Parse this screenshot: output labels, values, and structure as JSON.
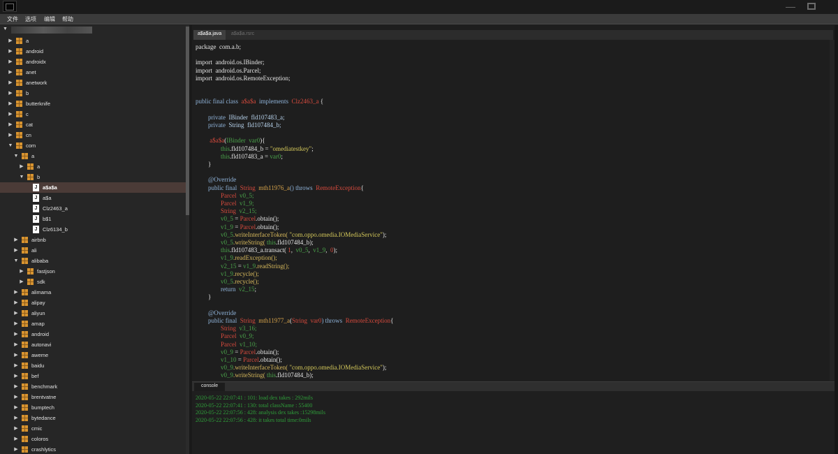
{
  "window": {
    "controls": {
      "minimize": "—",
      "maximize": "",
      "close": ""
    }
  },
  "menu": [
    "文件",
    "选项",
    "编辑",
    "帮助"
  ],
  "tree": [
    {
      "label": "a",
      "arrow": "▶",
      "icon": "folder",
      "depth": 0
    },
    {
      "label": "android",
      "arrow": "▶",
      "icon": "folder",
      "depth": 0
    },
    {
      "label": "androidx",
      "arrow": "▶",
      "icon": "folder",
      "depth": 0
    },
    {
      "label": "anet",
      "arrow": "▶",
      "icon": "folder",
      "depth": 0
    },
    {
      "label": "anetwork",
      "arrow": "▶",
      "icon": "folder",
      "depth": 0
    },
    {
      "label": "b",
      "arrow": "▶",
      "icon": "folder",
      "depth": 0
    },
    {
      "label": "butterknife",
      "arrow": "▶",
      "icon": "folder",
      "depth": 0
    },
    {
      "label": "c",
      "arrow": "▶",
      "icon": "folder",
      "depth": 0
    },
    {
      "label": "cat",
      "arrow": "▶",
      "icon": "folder",
      "depth": 0
    },
    {
      "label": "cn",
      "arrow": "▶",
      "icon": "folder",
      "depth": 0
    },
    {
      "label": "com",
      "arrow": "▼",
      "icon": "folder",
      "depth": 0
    },
    {
      "label": "a",
      "arrow": "▼",
      "icon": "folder",
      "depth": 1
    },
    {
      "label": "a",
      "arrow": "▶",
      "icon": "folder",
      "depth": 2
    },
    {
      "label": "b",
      "arrow": "▼",
      "icon": "folder",
      "depth": 2
    },
    {
      "label": "a$a$a",
      "arrow": "",
      "icon": "file",
      "depth": 3,
      "selected": true
    },
    {
      "label": "a$a",
      "arrow": "",
      "icon": "file",
      "depth": 3
    },
    {
      "label": "Clz2463_a",
      "arrow": "",
      "icon": "file",
      "depth": 3
    },
    {
      "label": "b$1",
      "arrow": "",
      "icon": "file",
      "depth": 3
    },
    {
      "label": "Clz6134_b",
      "arrow": "",
      "icon": "file",
      "depth": 3
    },
    {
      "label": "airbnb",
      "arrow": "▶",
      "icon": "folder",
      "depth": 1
    },
    {
      "label": "ali",
      "arrow": "▶",
      "icon": "folder",
      "depth": 1
    },
    {
      "label": "alibaba",
      "arrow": "▼",
      "icon": "folder",
      "depth": 1
    },
    {
      "label": "fastjson",
      "arrow": "▶",
      "icon": "folder",
      "depth": 2
    },
    {
      "label": "sdk",
      "arrow": "▶",
      "icon": "folder",
      "depth": 2
    },
    {
      "label": "alimama",
      "arrow": "▶",
      "icon": "folder",
      "depth": 1
    },
    {
      "label": "alipay",
      "arrow": "▶",
      "icon": "folder",
      "depth": 1
    },
    {
      "label": "aliyun",
      "arrow": "▶",
      "icon": "folder",
      "depth": 1
    },
    {
      "label": "amap",
      "arrow": "▶",
      "icon": "folder",
      "depth": 1
    },
    {
      "label": "android",
      "arrow": "▶",
      "icon": "folder",
      "depth": 1
    },
    {
      "label": "autonavi",
      "arrow": "▶",
      "icon": "folder",
      "depth": 1
    },
    {
      "label": "aweme",
      "arrow": "▶",
      "icon": "folder",
      "depth": 1
    },
    {
      "label": "baidu",
      "arrow": "▶",
      "icon": "folder",
      "depth": 1
    },
    {
      "label": "bef",
      "arrow": "▶",
      "icon": "folder",
      "depth": 1
    },
    {
      "label": "benchmark",
      "arrow": "▶",
      "icon": "folder",
      "depth": 1
    },
    {
      "label": "brentvatne",
      "arrow": "▶",
      "icon": "folder",
      "depth": 1
    },
    {
      "label": "bumptech",
      "arrow": "▶",
      "icon": "folder",
      "depth": 1
    },
    {
      "label": "bytedance",
      "arrow": "▶",
      "icon": "folder",
      "depth": 1
    },
    {
      "label": "cmic",
      "arrow": "▶",
      "icon": "folder",
      "depth": 1
    },
    {
      "label": "coloros",
      "arrow": "▶",
      "icon": "folder",
      "depth": 1
    },
    {
      "label": "crashlytics",
      "arrow": "▶",
      "icon": "folder",
      "depth": 1
    }
  ],
  "tabs": [
    "a$a$a.java",
    "a$a$a.rsrc"
  ],
  "code": [
    [
      {
        "t": "package  com.a.b;",
        "c": "s"
      }
    ],
    [],
    [
      {
        "t": "import  android.os.IBinder;",
        "c": "s"
      }
    ],
    [
      {
        "t": "import  android.os.Parcel;",
        "c": "s"
      }
    ],
    [
      {
        "t": "import  android.os.RemoteException;",
        "c": "s"
      }
    ],
    [],
    [],
    [
      {
        "t": "public final class  ",
        "c": "k"
      },
      {
        "t": "a$a$a",
        "c": "r"
      },
      {
        "t": "  implements  ",
        "c": "k"
      },
      {
        "t": "Clz2463_a",
        "c": "r"
      },
      {
        "t": " {",
        "c": "s"
      }
    ],
    [],
    [
      {
        "t": "        private  ",
        "c": "k"
      },
      {
        "t": "IBinder",
        "c": "t"
      },
      {
        "t": "  fld107483_a;",
        "c": "t"
      }
    ],
    [
      {
        "t": "        private  ",
        "c": "k"
      },
      {
        "t": "String",
        "c": "t"
      },
      {
        "t": "  fld107484_b;",
        "c": "t"
      }
    ],
    [],
    [
      {
        "t": "         ",
        "c": "s"
      },
      {
        "t": "a$a$a",
        "c": "r"
      },
      {
        "t": "(",
        "c": "s"
      },
      {
        "t": "IBinder  var0",
        "c": "g"
      },
      {
        "t": "){",
        "c": "s"
      }
    ],
    [
      {
        "t": "                ",
        "c": "s"
      },
      {
        "t": "this",
        "c": "g"
      },
      {
        "t": ".fld107484_b = ",
        "c": "s"
      },
      {
        "t": "\"omediatestkey\"",
        "c": "y"
      },
      {
        "t": ";",
        "c": "s"
      }
    ],
    [
      {
        "t": "                ",
        "c": "s"
      },
      {
        "t": "this",
        "c": "g"
      },
      {
        "t": ".fld107483_a = ",
        "c": "s"
      },
      {
        "t": "var0",
        "c": "g"
      },
      {
        "t": ";",
        "c": "s"
      }
    ],
    [
      {
        "t": "        }",
        "c": "s"
      }
    ],
    [],
    [
      {
        "t": "        @Override",
        "c": "k"
      }
    ],
    [
      {
        "t": "        public final  ",
        "c": "k"
      },
      {
        "t": "String",
        "c": "r"
      },
      {
        "t": "  mth11976_a",
        "c": "o"
      },
      {
        "t": "() throws  ",
        "c": "k"
      },
      {
        "t": "RemoteException",
        "c": "r"
      },
      {
        "t": "{",
        "c": "s"
      }
    ],
    [
      {
        "t": "                Parcel",
        "c": "r"
      },
      {
        "t": "  v0_5;",
        "c": "g"
      }
    ],
    [
      {
        "t": "                Parcel",
        "c": "r"
      },
      {
        "t": "  v1_9;",
        "c": "g"
      }
    ],
    [
      {
        "t": "                String",
        "c": "r"
      },
      {
        "t": "  v2_15;",
        "c": "g"
      }
    ],
    [
      {
        "t": "                v0_5",
        "c": "g"
      },
      {
        "t": " = ",
        "c": "s"
      },
      {
        "t": "Parcel",
        "c": "r"
      },
      {
        "t": ".obtain();",
        "c": "s"
      }
    ],
    [
      {
        "t": "                v1_9",
        "c": "g"
      },
      {
        "t": " = ",
        "c": "s"
      },
      {
        "t": "Parcel",
        "c": "r"
      },
      {
        "t": ".obtain();",
        "c": "s"
      }
    ],
    [
      {
        "t": "                v0_5",
        "c": "g"
      },
      {
        "t": ".writeInterfaceToken( ",
        "c": "m"
      },
      {
        "t": "\"com.oppo.omedia.IOMediaService\"",
        "c": "y"
      },
      {
        "t": ");",
        "c": "s"
      }
    ],
    [
      {
        "t": "                v0_5",
        "c": "g"
      },
      {
        "t": ".writeString( ",
        "c": "m"
      },
      {
        "t": "this",
        "c": "g"
      },
      {
        "t": ".fld107484_b);",
        "c": "s"
      }
    ],
    [
      {
        "t": "                this",
        "c": "g"
      },
      {
        "t": ".fld107483_a.transact( ",
        "c": "s"
      },
      {
        "t": "1",
        "c": "r"
      },
      {
        "t": ",  ",
        "c": "s"
      },
      {
        "t": "v0_5",
        "c": "g"
      },
      {
        "t": ",  ",
        "c": "s"
      },
      {
        "t": "v1_9",
        "c": "g"
      },
      {
        "t": ",  ",
        "c": "s"
      },
      {
        "t": "0",
        "c": "r"
      },
      {
        "t": ");",
        "c": "s"
      }
    ],
    [
      {
        "t": "                v1_9",
        "c": "g"
      },
      {
        "t": ".readException();",
        "c": "m"
      }
    ],
    [
      {
        "t": "                v2_15",
        "c": "g"
      },
      {
        "t": " = ",
        "c": "s"
      },
      {
        "t": "v1_9",
        "c": "g"
      },
      {
        "t": ".readString();",
        "c": "m"
      }
    ],
    [
      {
        "t": "                v1_9",
        "c": "g"
      },
      {
        "t": ".recycle();",
        "c": "m"
      }
    ],
    [
      {
        "t": "                v0_5",
        "c": "g"
      },
      {
        "t": ".recycle();",
        "c": "m"
      }
    ],
    [
      {
        "t": "                return  ",
        "c": "k"
      },
      {
        "t": "v2_15",
        "c": "g"
      },
      {
        "t": ";",
        "c": "s"
      }
    ],
    [
      {
        "t": "        }",
        "c": "s"
      }
    ],
    [],
    [
      {
        "t": "        @Override",
        "c": "k"
      }
    ],
    [
      {
        "t": "        public final  ",
        "c": "k"
      },
      {
        "t": "String",
        "c": "r"
      },
      {
        "t": "  mth11977_a",
        "c": "o"
      },
      {
        "t": "(",
        "c": "s"
      },
      {
        "t": "String  var0",
        "c": "r"
      },
      {
        "t": ") throws  ",
        "c": "k"
      },
      {
        "t": "RemoteException",
        "c": "r"
      },
      {
        "t": "{",
        "c": "s"
      }
    ],
    [
      {
        "t": "                String",
        "c": "r"
      },
      {
        "t": "  v3_16;",
        "c": "g"
      }
    ],
    [
      {
        "t": "                Parcel",
        "c": "r"
      },
      {
        "t": "  v0_9;",
        "c": "g"
      }
    ],
    [
      {
        "t": "                Parcel",
        "c": "r"
      },
      {
        "t": "  v1_10;",
        "c": "g"
      }
    ],
    [
      {
        "t": "                v0_9",
        "c": "g"
      },
      {
        "t": " = ",
        "c": "s"
      },
      {
        "t": "Parcel",
        "c": "r"
      },
      {
        "t": ".obtain();",
        "c": "s"
      }
    ],
    [
      {
        "t": "                v1_10",
        "c": "g"
      },
      {
        "t": " = ",
        "c": "s"
      },
      {
        "t": "Parcel",
        "c": "r"
      },
      {
        "t": ".obtain();",
        "c": "s"
      }
    ],
    [
      {
        "t": "                v0_9",
        "c": "g"
      },
      {
        "t": ".writeInterfaceToken( ",
        "c": "m"
      },
      {
        "t": "\"com.oppo.omedia.IOMediaService\"",
        "c": "y"
      },
      {
        "t": ");",
        "c": "s"
      }
    ],
    [
      {
        "t": "                v0_9",
        "c": "g"
      },
      {
        "t": ".writeString( ",
        "c": "m"
      },
      {
        "t": "this",
        "c": "g"
      },
      {
        "t": ".fld107484_b);",
        "c": "s"
      }
    ]
  ],
  "console": {
    "tab_label": "console",
    "logs": [
      "2020-05-22 22:07:41 : 101: load dex takes : 292mils",
      "2020-05-22 22:07:41 : 130: total className : 55400",
      "2020-05-22 22:07:56 : 428: analysis dex takes :15298mils",
      "2020-05-22 22:07:56 : 428: it takes total time:0mils"
    ]
  }
}
